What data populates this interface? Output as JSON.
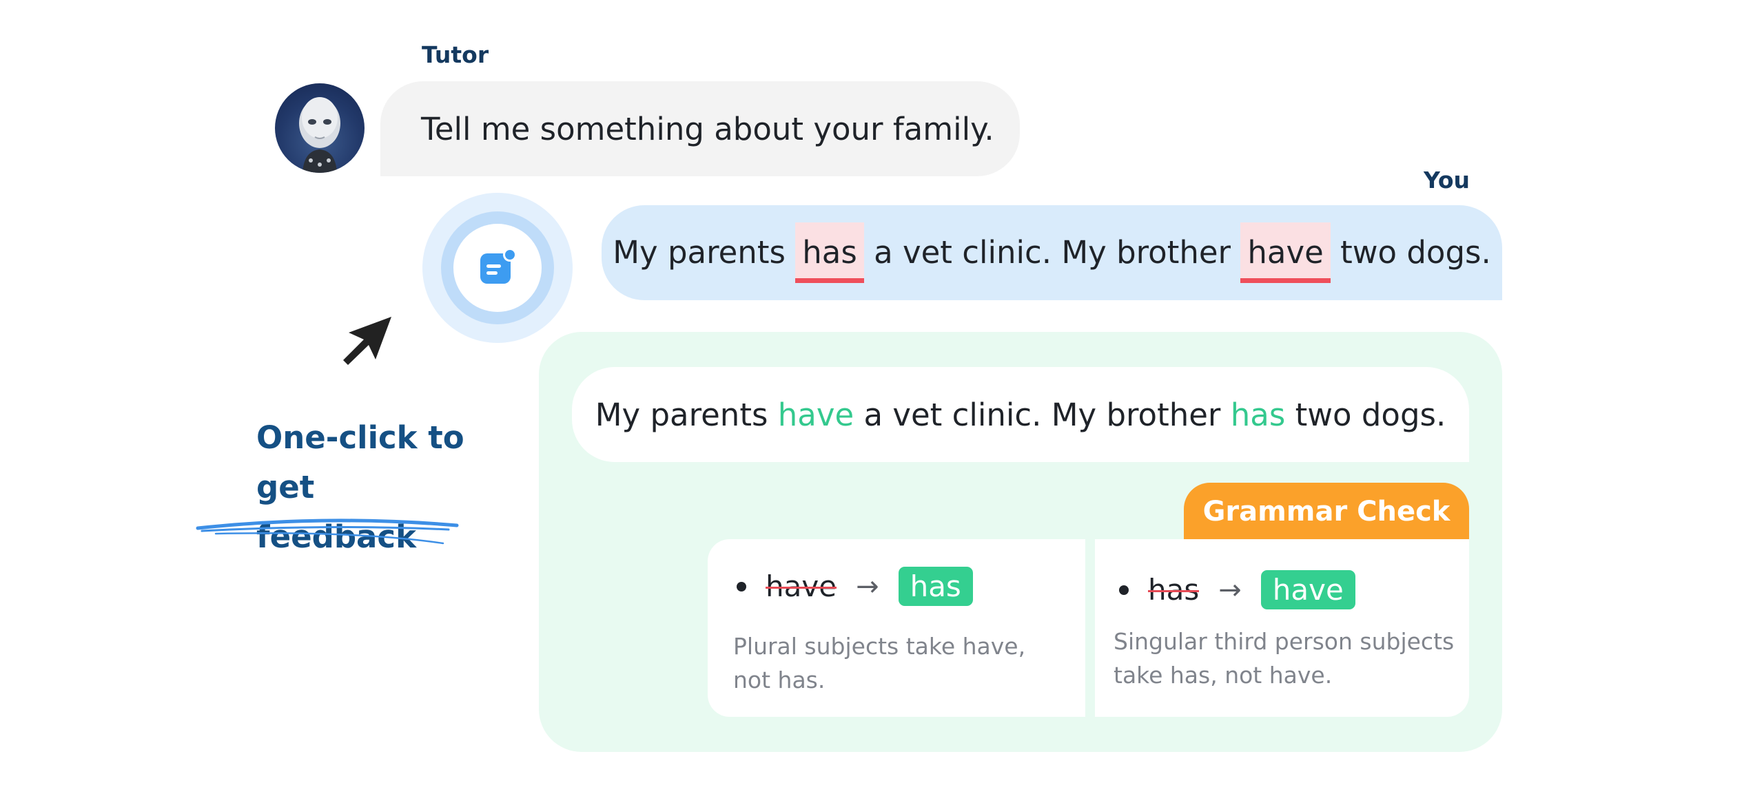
{
  "tutor": {
    "label": "Tutor",
    "message": "Tell me something about your family."
  },
  "user": {
    "label": "You",
    "segments": [
      "My parents ",
      "has",
      " a vet clinic. My brother ",
      "have",
      " two dogs."
    ]
  },
  "feedback": {
    "corrected_segments": [
      "My parents ",
      "have",
      " a vet clinic. My brother ",
      "has",
      " two dogs."
    ],
    "section_title": "Grammar Check",
    "rules": [
      {
        "wrong": "have",
        "right": "has",
        "explanation": "Plural subjects take have, not has."
      },
      {
        "wrong": "has",
        "right": "have",
        "explanation": "Singular third person subjects take has, not have."
      }
    ]
  },
  "callout": {
    "line1": "One-click to",
    "line2": "get feedback"
  },
  "icons": {
    "arrow": "→",
    "feedback_button": "feedback-chat-icon",
    "cursor": "cursor-arrow-icon"
  },
  "colors": {
    "error": "#ef4f5b",
    "correct": "#34c98e",
    "grammar_tab": "#fba12a",
    "user_bubble": "#d9ebfb",
    "panel": "#e8faf1"
  }
}
